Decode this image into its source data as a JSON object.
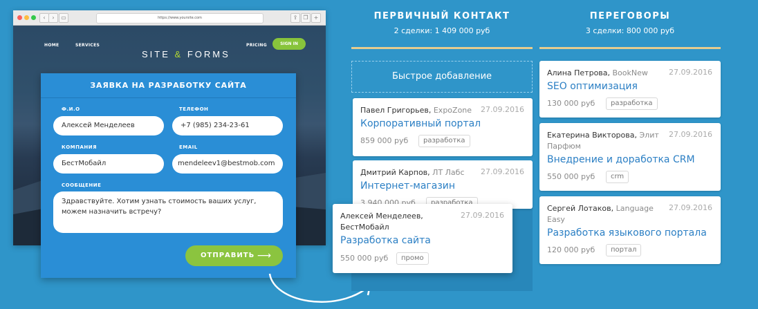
{
  "browser": {
    "url": "https://www.yoursite.com",
    "nav_home": "HOME",
    "nav_services": "SERVICES",
    "logo_left": "SITE",
    "logo_amp": "&",
    "logo_right": "FORMS",
    "nav_pricing": "PRICING",
    "sign_in": "SIGN IN"
  },
  "form": {
    "title": "ЗАЯВКА НА РАЗРАБОТКУ САЙТА",
    "fio_label": "Ф.И.О",
    "fio_value": "Алексей Менделеев",
    "phone_label": "ТЕЛЕФОН",
    "phone_value": "+7 (985) 234-23-61",
    "company_label": "КОМПАНИЯ",
    "company_value": "БестМобайл",
    "email_label": "EMAIL",
    "email_value": "mendeleev1@bestmob.com",
    "message_label": "СООБЩЕНИЕ",
    "message_value": "Здравствуйте. Хотим узнать стоимость ваших услуг, можем назначить встречу?",
    "submit_label": "ОТПРАВИТЬ",
    "submit_arrow": "⟶"
  },
  "columns": [
    {
      "title": "ПЕРВИЧНЫЙ КОНТАКТ",
      "subtitle": "2 сделки: 1 409 000 руб",
      "quick_add": "Быстрое добавление",
      "cards": [
        {
          "person": "Павел Григорьев,",
          "company": "ExpoZone",
          "date": "27.09.2016",
          "deal": "Корпоративный портал",
          "price": "859 000 руб",
          "tag": "разработка"
        },
        {
          "person": "Дмитрий Карпов,",
          "company": "ЛТ Лабс",
          "date": "27.09.2016",
          "deal": "Интернет-магазин",
          "price": "3 940 000 руб",
          "tag": "разработка"
        }
      ]
    },
    {
      "title": "ПЕРЕГОВОРЫ",
      "subtitle": "3 сделки: 800 000 руб",
      "cards": [
        {
          "person": "Алина Петрова,",
          "company": "BookNew",
          "date": "27.09.2016",
          "deal": "SEO оптимизация",
          "price": "130 000 руб",
          "tag": "разработка"
        },
        {
          "person": "Екатерина Викторова,",
          "company": "Элит Парфюм",
          "date": "27.09.2016",
          "deal": "Внедрение и доработка CRM",
          "price": "550 000 руб",
          "tag": "crm"
        },
        {
          "person": "Сергей Лотаков,",
          "company": "Language Easy",
          "date": "27.09.2016",
          "deal": "Разработка языкового портала",
          "price": "120 000 руб",
          "tag": "портал"
        }
      ]
    }
  ],
  "new_card": {
    "person": "Алексей Менделеев,",
    "company": "БестМобайл",
    "date": "27.09.2016",
    "deal": "Разработка сайта",
    "price": "550 000 руб",
    "tag": "промо"
  }
}
